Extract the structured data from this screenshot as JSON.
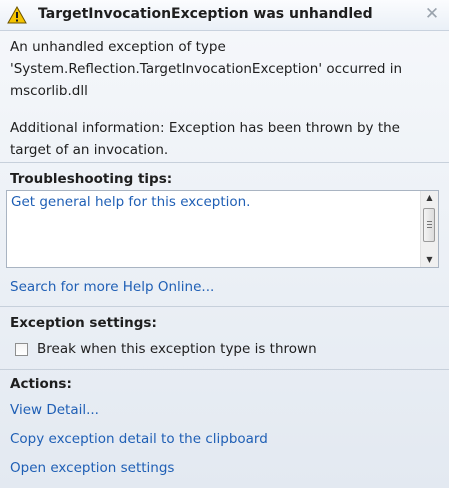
{
  "dialog": {
    "title": "TargetInvocationException was unhandled",
    "icons": {
      "warning": "warning-icon",
      "close": "close-icon"
    },
    "message_lines": [
      "An unhandled exception of type",
      "'System.Reflection.TargetInvocationException' occurred in",
      "mscorlib.dll"
    ],
    "additional_lines": [
      "Additional information: Exception has been thrown by the",
      "target of an invocation."
    ]
  },
  "troubleshooting": {
    "heading": "Troubleshooting tips:",
    "tips": [
      "Get general help for this exception."
    ],
    "search_link": "Search for more Help Online..."
  },
  "exception_settings": {
    "heading": "Exception settings:",
    "checkbox_label": "Break when this exception type is thrown",
    "checked": false
  },
  "actions": {
    "heading": "Actions:",
    "items": [
      "View Detail...",
      "Copy exception detail to the clipboard",
      "Open exception settings"
    ]
  },
  "colors": {
    "link": "#1f5fb5",
    "warning_fill": "#f5c400",
    "separator": "#c7d0db"
  }
}
